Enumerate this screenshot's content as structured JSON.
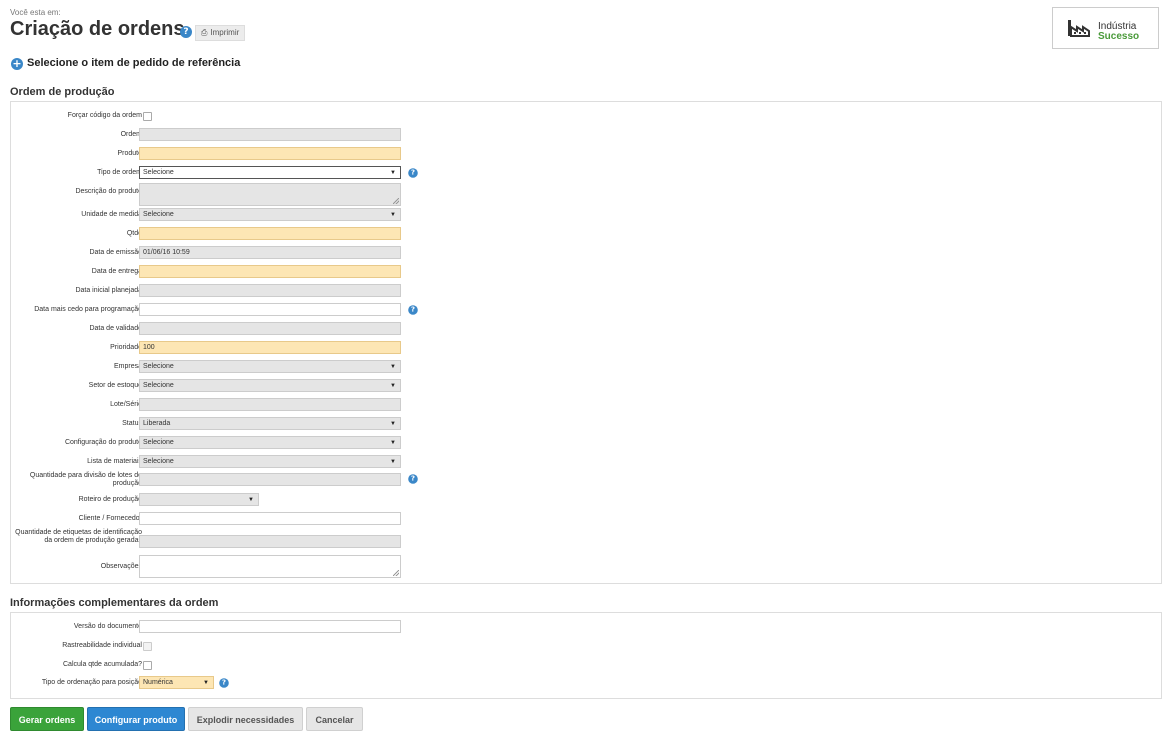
{
  "header": {
    "breadcrumb": "Você esta em:",
    "title": "Criação de ordens",
    "print_label": "Imprimir",
    "logo_line1": "Indústria",
    "logo_line2": "Sucesso"
  },
  "reference_link": "Selecione o item de pedido de referência",
  "production": {
    "section_title": "Ordem de produção",
    "fields": {
      "forcar": "Forçar código da ordem",
      "ordem": "Ordem",
      "produto": "Produto",
      "tipo_ordem": "Tipo de ordem",
      "tipo_ordem_value": "Selecione",
      "descricao": "Descrição do produto",
      "unidade": "Unidade de medida",
      "unidade_value": "Selecione",
      "qtde": "Qtde",
      "data_emissao": "Data de emissão",
      "data_emissao_value": "01/06/16 10:59",
      "data_entrega": "Data de entrega",
      "data_inicial": "Data inicial planejada",
      "data_mais_cedo": "Data mais cedo para programação",
      "data_validade": "Data de validade",
      "prioridade": "Prioridade",
      "prioridade_value": "100",
      "empresa": "Empresa",
      "empresa_value": "Selecione",
      "setor": "Setor de estoque",
      "setor_value": "Selecione",
      "lote": "Lote/Série",
      "status": "Status",
      "status_value": "Liberada",
      "configuracao": "Configuração do produto",
      "configuracao_value": "Selecione",
      "lista": "Lista de materiais",
      "lista_value": "Selecione",
      "qtd_divisao": "Quantidade para divisão de lotes de produção",
      "roteiro": "Roteiro de produção",
      "cliente": "Cliente / Fornecedor",
      "qtd_etiquetas": "Quantidade de etiquetas de identificação da ordem de produção geradas",
      "observacoes": "Observações"
    }
  },
  "complementary": {
    "section_title": "Informações complementares da ordem",
    "fields": {
      "versao": "Versão do documento",
      "rastreabilidade": "Rastreabilidade individual",
      "calcula": "Calcula qtde acumulada?",
      "tipo_ordenacao": "Tipo de ordenação para posição",
      "tipo_ordenacao_value": "Numérica"
    }
  },
  "buttons": {
    "gerar": "Gerar ordens",
    "configurar": "Configurar produto",
    "explodir": "Explodir necessidades",
    "cancelar": "Cancelar"
  },
  "colors": {
    "primary_green": "#3aa33a",
    "primary_blue": "#2d87d2",
    "required_field": "#fde6b4"
  }
}
